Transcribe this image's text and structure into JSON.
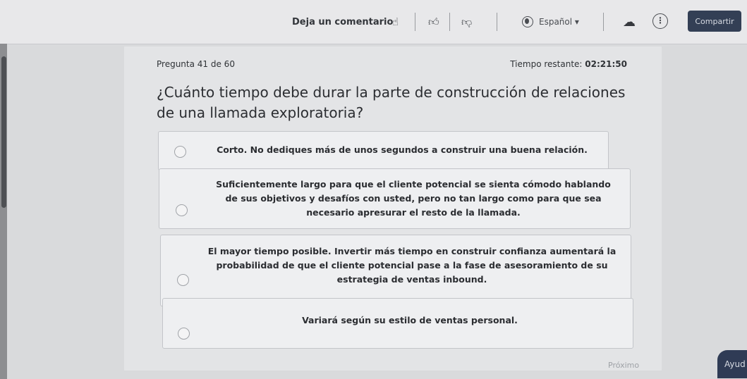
{
  "topbar": {
    "comment_label": "Deja un comentario",
    "language_label": "Español ▾",
    "share_label": "Compartir"
  },
  "icons": {
    "feedback": "thumbs-up-sparkle-icon",
    "like": "thumbs-up-icon",
    "dislike": "thumbs-down-icon",
    "language": "globe-icon",
    "cloud": "cloud-upload-icon",
    "more": "more-vertical-icon"
  },
  "quiz": {
    "question_number": "Pregunta 41 de 60",
    "time_label": "Tiempo restante:",
    "time_value": "02:21:50",
    "question_text": "¿Cuánto tiempo debe durar la parte de construcción de relaciones de una llamada exploratoria?",
    "options": [
      {
        "label": "Corto. No dediques más de unos segundos a construir una buena relación."
      },
      {
        "label": "Suficientemente largo para que el cliente potencial se sienta cómodo hablando de sus objetivos y desafíos con usted, pero no tan largo como para que sea necesario apresurar el resto de la llamada."
      },
      {
        "label": "El mayor tiempo posible. Invertir más tiempo en construir confianza aumentará la probabilidad de que el cliente potencial pase a la fase de asesoramiento de su estrategia de ventas inbound."
      },
      {
        "label": "Variará según su estilo de ventas personal."
      }
    ],
    "next_label": "Próximo"
  },
  "help": {
    "label": "Ayud"
  },
  "colors": {
    "share_bg": "#333f55",
    "help_bg": "#2f3b55"
  }
}
